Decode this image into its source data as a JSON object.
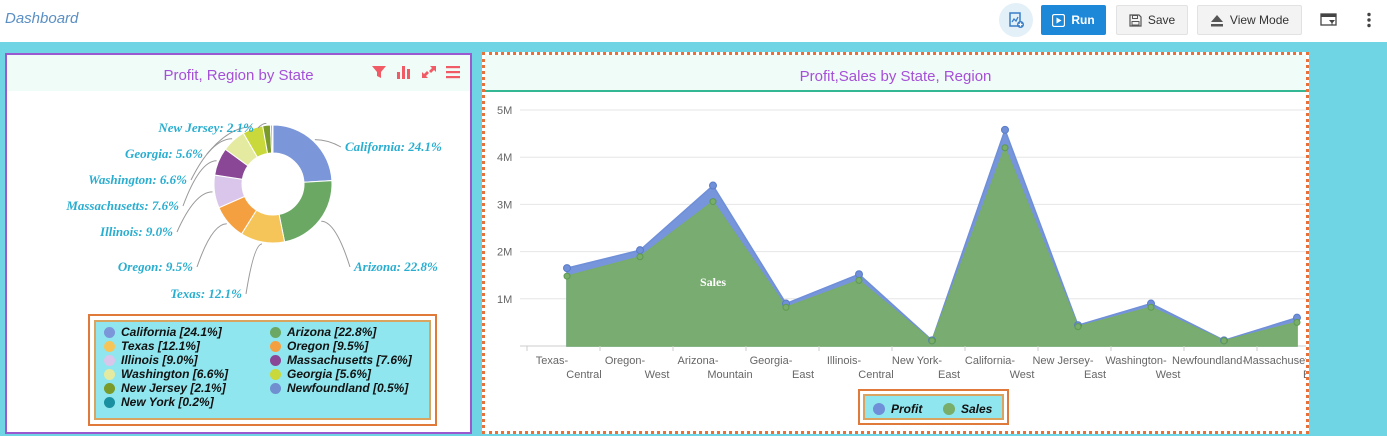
{
  "header": {
    "title": "Dashboard",
    "run_label": "Run",
    "save_label": "Save",
    "view_mode_label": "View Mode"
  },
  "pie_panel": {
    "title": "Profit, Region by State",
    "slice_labels": [
      "California: 24.1%",
      "Arizona: 22.8%",
      "Texas: 12.1%",
      "Oregon: 9.5%",
      "Illinois: 9.0%",
      "Massachusetts: 7.6%",
      "Washington: 6.6%",
      "Georgia: 5.6%",
      "New Jersey: 2.1%"
    ],
    "legend": [
      {
        "label": "California [24.1%]",
        "color": "#7b96d9"
      },
      {
        "label": "Arizona [22.8%]",
        "color": "#6aa864"
      },
      {
        "label": "Texas [12.1%]",
        "color": "#f5c55a"
      },
      {
        "label": "Oregon [9.5%]",
        "color": "#f5a040"
      },
      {
        "label": "Illinois [9.0%]",
        "color": "#dac6ea"
      },
      {
        "label": "Massachusetts [7.6%]",
        "color": "#8a4796"
      },
      {
        "label": "Washington [6.6%]",
        "color": "#e4eba0"
      },
      {
        "label": "Georgia [5.6%]",
        "color": "#c9d83a"
      },
      {
        "label": "New Jersey [2.1%]",
        "color": "#7a9a2a"
      },
      {
        "label": "Newfoundland [0.5%]",
        "color": "#6f8fd0"
      },
      {
        "label": "New York [0.2%]",
        "color": "#1a8fa0"
      }
    ]
  },
  "area_panel": {
    "title": "Profit,Sales by State, Region",
    "area_label": "Sales",
    "legend": [
      {
        "label": "Profit",
        "color": "#6f8fd8"
      },
      {
        "label": "Sales",
        "color": "#78ad6a"
      }
    ]
  },
  "chart_data": [
    {
      "type": "pie",
      "title": "Profit, Region by State",
      "categories": [
        "California",
        "Arizona",
        "Texas",
        "Oregon",
        "Illinois",
        "Massachusetts",
        "Washington",
        "Georgia",
        "New Jersey",
        "Newfoundland",
        "New York"
      ],
      "values": [
        24.1,
        22.8,
        12.1,
        9.5,
        9.0,
        7.6,
        6.6,
        5.6,
        2.1,
        0.5,
        0.2
      ],
      "colors": [
        "#7b96d9",
        "#6aa864",
        "#f5c55a",
        "#f5a040",
        "#dac6ea",
        "#8a4796",
        "#e4eba0",
        "#c9d83a",
        "#7a9a2a",
        "#6f8fd0",
        "#1a8fa0"
      ],
      "donut": true,
      "legend": "bottom"
    },
    {
      "type": "area",
      "title": "Profit,Sales by State, Region",
      "categories": [
        "Texas-Central",
        "Oregon-West",
        "Arizona-Mountain",
        "Georgia-East",
        "Illinois-Central",
        "New York-East",
        "California-West",
        "New Jersey-East",
        "Washington-West",
        "Newfoundland-",
        "Massachusetts-East"
      ],
      "yticks": [
        "1M",
        "2M",
        "3M",
        "4M",
        "5M"
      ],
      "ylim": [
        0,
        5000000
      ],
      "series": [
        {
          "name": "Profit",
          "values": [
            1650000,
            2030000,
            3400000,
            900000,
            1520000,
            120000,
            4580000,
            440000,
            900000,
            120000,
            600000
          ],
          "color": "#6f8fd8"
        },
        {
          "name": "Sales",
          "values": [
            1480000,
            1890000,
            3060000,
            820000,
            1390000,
            110000,
            4200000,
            410000,
            820000,
            110000,
            500000
          ],
          "color": "#78ad6a"
        }
      ],
      "legend": "bottom",
      "grid": true
    }
  ]
}
